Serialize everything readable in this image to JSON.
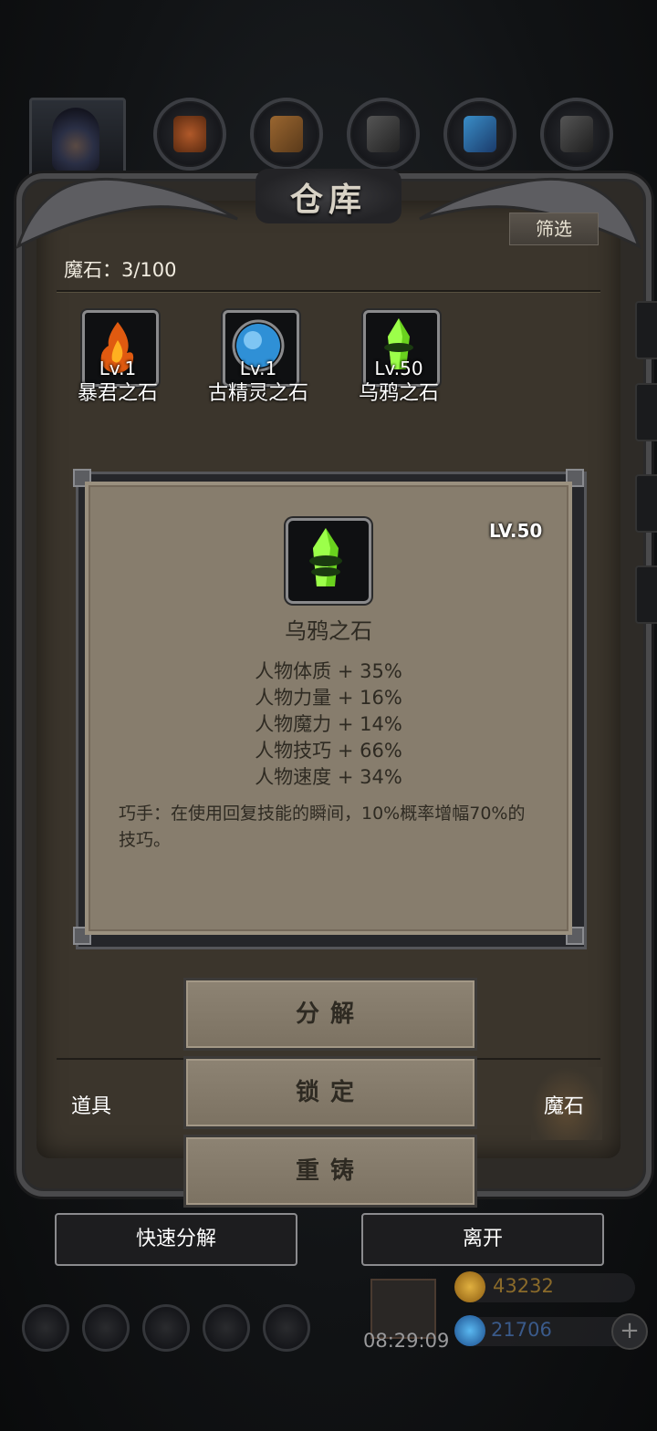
{
  "title": "仓库",
  "filter_label": "筛选",
  "capacity_text": "魔石：3/100",
  "items": [
    {
      "lv": "Lv.1",
      "name": "暴君之石",
      "icon": "fire-stone-icon"
    },
    {
      "lv": "Lv.1",
      "name": "古精灵之石",
      "icon": "blue-orb-stone-icon"
    },
    {
      "lv": "Lv.50",
      "name": "乌鸦之石",
      "icon": "green-crystal-stone-icon"
    }
  ],
  "detail": {
    "level": "LV.50",
    "name": "乌鸦之石",
    "stats": [
      "人物体质 + 35%",
      "人物力量 + 16%",
      "人物魔力 + 14%",
      "人物技巧 + 66%",
      "人物速度 + 34%"
    ],
    "description": "巧手：在使用回复技能的瞬间，10%概率增幅70%的技巧。"
  },
  "actions": {
    "decompose": "分解",
    "lock": "锁定",
    "reforge": "重铸"
  },
  "tabs": {
    "items": "道具",
    "stones": "魔石"
  },
  "buttons": {
    "quick_decompose": "快速分解",
    "leave": "离开"
  },
  "hud": {
    "timer": "08:29:09",
    "gold": "43232",
    "gems": "21706"
  }
}
